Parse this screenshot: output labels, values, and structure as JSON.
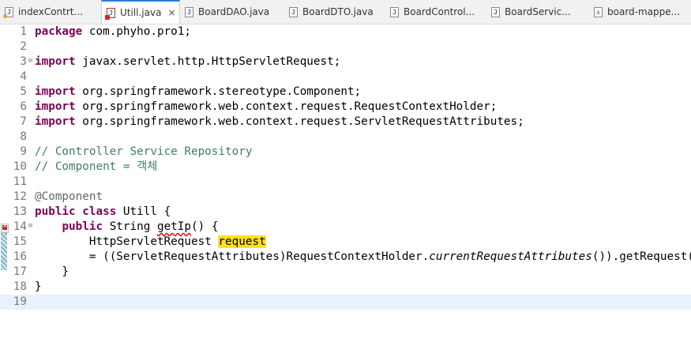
{
  "tabs": [
    {
      "label": "indexContrt...",
      "icon": "java-file-icon",
      "active": false,
      "kind": "java-mod"
    },
    {
      "label": "Utill.java",
      "icon": "java-error-file-icon",
      "active": true,
      "kind": "err",
      "close": "×"
    },
    {
      "label": "BoardDAO.java",
      "icon": "java-file-icon",
      "active": false,
      "kind": "java"
    },
    {
      "label": "BoardDTO.java",
      "icon": "java-file-icon",
      "active": false,
      "kind": "java"
    },
    {
      "label": "BoardControl...",
      "icon": "java-file-icon",
      "active": false,
      "kind": "java"
    },
    {
      "label": "BoardServic...",
      "icon": "java-file-icon",
      "active": false,
      "kind": "java"
    },
    {
      "label": "board-mappe...",
      "icon": "xml-file-icon",
      "active": false,
      "kind": "xml"
    }
  ],
  "editor": {
    "lines": [
      {
        "n": "1"
      },
      {
        "n": "2"
      },
      {
        "n": "3"
      },
      {
        "n": "4"
      },
      {
        "n": "5"
      },
      {
        "n": "6"
      },
      {
        "n": "7"
      },
      {
        "n": "8"
      },
      {
        "n": "9"
      },
      {
        "n": "10"
      },
      {
        "n": "11"
      },
      {
        "n": "12"
      },
      {
        "n": "13"
      },
      {
        "n": "14"
      },
      {
        "n": "15"
      },
      {
        "n": "16"
      },
      {
        "n": "17"
      },
      {
        "n": "18"
      },
      {
        "n": "19"
      }
    ],
    "code": {
      "l1_kw": "package",
      "l1_rest": " com.phyho.pro1;",
      "l3_kw": "import",
      "l3_rest": " javax.servlet.http.HttpServletRequest;",
      "l5_kw": "import",
      "l5_rest": " org.springframework.stereotype.Component;",
      "l6_kw": "import",
      "l6_rest": " org.springframework.web.context.request.RequestContextHolder;",
      "l7_kw": "import",
      "l7_rest": " org.springframework.web.context.request.ServletRequestAttributes;",
      "l9": "// Controller Service Repository",
      "l10": "// Component = 객체",
      "l12": "@Component",
      "l13_kw1": "public",
      "l13_kw2": "class",
      "l13_rest": " Utill {",
      "l14_indent": "    ",
      "l14_kw": "public",
      "l14_type": " String ",
      "l14_method": "getIp",
      "l14_rest": "() {",
      "l15_indent": "        ",
      "l15_type": "HttpServletRequest ",
      "l15_var": "request",
      "l16_indent": "        ",
      "l16_a": "= ((ServletRequestAttributes)RequestContextHolder.",
      "l16_it": "currentRequestAttributes",
      "l16_b": "()).getRequest();",
      "l17": "    }",
      "l18": "}"
    },
    "fold_glyph": "⊖"
  }
}
